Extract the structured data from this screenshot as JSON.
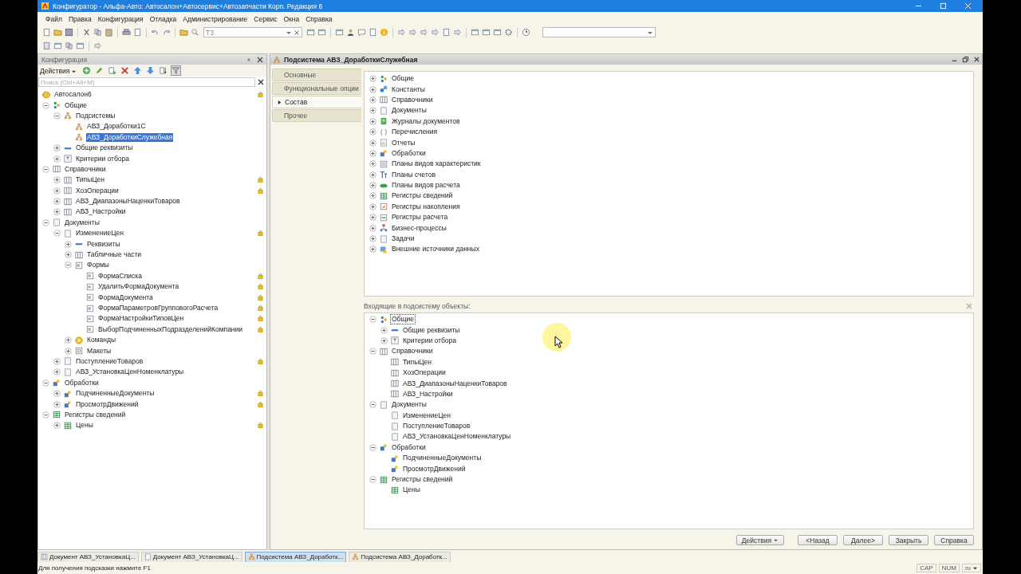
{
  "window": {
    "title": "Конфигуратор - Альфа-Авто: Автосалон+Автосервис+Автозапчасти Корп. Редакция 6"
  },
  "menu": [
    "Файл",
    "Правка",
    "Конфигурация",
    "Отладка",
    "Администрирование",
    "Сервис",
    "Окна",
    "Справка"
  ],
  "toolbar": {
    "search_value": "Т3"
  },
  "config_panel": {
    "title": "Конфигурация",
    "actions_label": "Действия",
    "search_placeholder": "Поиск (Ctrl+Alt+M)",
    "tree": [
      {
        "label": "Автосалон6",
        "kind": "root",
        "selected": false,
        "locked": true,
        "children": [
          {
            "label": "Общие",
            "kind": "common",
            "expanded": true,
            "selected": false,
            "locked": false,
            "children": [
              {
                "label": "Подсистемы",
                "kind": "subsystem",
                "expanded": true,
                "selected": false,
                "locked": false,
                "children": [
                  {
                    "label": "АВЗ_Доработки1С",
                    "kind": "subsystem",
                    "selected": false,
                    "locked": false
                  },
                  {
                    "label": "АВЗ_ДоработкиСлужебная",
                    "kind": "subsystem",
                    "selected": true,
                    "locked": false
                  }
                ]
              },
              {
                "label": "Общие реквизиты",
                "kind": "attributes",
                "expanded": false,
                "selected": false,
                "locked": false
              },
              {
                "label": "Критерии отбора",
                "kind": "filter",
                "expanded": false,
                "selected": false,
                "locked": false
              }
            ]
          },
          {
            "label": "Справочники",
            "kind": "catalog",
            "expanded": true,
            "selected": false,
            "locked": false,
            "children": [
              {
                "label": "ТипыЦен",
                "kind": "catalog",
                "expanded": false,
                "selected": false,
                "locked": true
              },
              {
                "label": "ХозОперации",
                "kind": "catalog",
                "expanded": false,
                "selected": false,
                "locked": true
              },
              {
                "label": "АВЗ_ДиапазоныНаценкиТоваров",
                "kind": "catalog",
                "expanded": false,
                "selected": false,
                "locked": false
              },
              {
                "label": "АВЗ_Настройки",
                "kind": "catalog",
                "expanded": false,
                "selected": false,
                "locked": false
              }
            ]
          },
          {
            "label": "Документы",
            "kind": "document",
            "expanded": true,
            "selected": false,
            "locked": false,
            "children": [
              {
                "label": "ИзменениеЦен",
                "kind": "document",
                "expanded": true,
                "selected": false,
                "locked": true,
                "children": [
                  {
                    "label": "Реквизиты",
                    "kind": "attributes",
                    "expanded": false,
                    "selected": false,
                    "locked": false
                  },
                  {
                    "label": "Табличные части",
                    "kind": "tabular",
                    "expanded": false,
                    "selected": false,
                    "locked": false
                  },
                  {
                    "label": "Формы",
                    "kind": "form",
                    "expanded": true,
                    "selected": false,
                    "locked": false,
                    "children": [
                      {
                        "label": "ФормаСписка",
                        "kind": "form",
                        "selected": false,
                        "locked": true
                      },
                      {
                        "label": "УдалитьФормаДокумента",
                        "kind": "form",
                        "selected": false,
                        "locked": true
                      },
                      {
                        "label": "ФормаДокумента",
                        "kind": "form",
                        "selected": false,
                        "locked": true
                      },
                      {
                        "label": "ФормаПараметровГрупповогоРасчета",
                        "kind": "form",
                        "selected": false,
                        "locked": true
                      },
                      {
                        "label": "ФормаНастройкиТиповЦен",
                        "kind": "form",
                        "selected": false,
                        "locked": true
                      },
                      {
                        "label": "ВыборПодчиненныхПодразделенийКомпании",
                        "kind": "form",
                        "selected": false,
                        "locked": true
                      }
                    ]
                  },
                  {
                    "label": "Команды",
                    "kind": "commands",
                    "expanded": false,
                    "selected": false,
                    "locked": false
                  },
                  {
                    "label": "Макеты",
                    "kind": "templates",
                    "expanded": false,
                    "selected": false,
                    "locked": false
                  }
                ]
              },
              {
                "label": "ПоступлениеТоваров",
                "kind": "document",
                "expanded": false,
                "selected": false,
                "locked": true
              },
              {
                "label": "АВЗ_УстановкаЦенНоменклатуры",
                "kind": "document",
                "expanded": false,
                "selected": false,
                "locked": false
              }
            ]
          },
          {
            "label": "Обработки",
            "kind": "dataprocessor",
            "expanded": true,
            "selected": false,
            "locked": false,
            "children": [
              {
                "label": "ПодчиненныеДокументы",
                "kind": "dataprocessor",
                "expanded": false,
                "selected": false,
                "locked": true
              },
              {
                "label": "ПросмотрДвижений",
                "kind": "dataprocessor",
                "expanded": false,
                "selected": false,
                "locked": true
              }
            ]
          },
          {
            "label": "Регистры сведений",
            "kind": "inforeg",
            "expanded": true,
            "selected": false,
            "locked": false,
            "children": [
              {
                "label": "Цены",
                "kind": "inforeg",
                "expanded": false,
                "selected": false,
                "locked": true
              }
            ]
          }
        ]
      }
    ]
  },
  "subsystem_window": {
    "title": "Подсистема АВЗ_ДоработкиСлужебная",
    "tabs": [
      {
        "label": "Основные",
        "selected": false
      },
      {
        "label": "Функциональные опции",
        "selected": false
      },
      {
        "label": "Состав",
        "selected": true
      },
      {
        "label": "Прочее",
        "selected": false
      }
    ],
    "object_types": [
      {
        "label": "Общие",
        "kind": "common",
        "expanded": false,
        "selected": false
      },
      {
        "label": "Константы",
        "kind": "constants",
        "expanded": false,
        "selected": false
      },
      {
        "label": "Справочники",
        "kind": "catalog",
        "expanded": false,
        "selected": false
      },
      {
        "label": "Документы",
        "kind": "document",
        "expanded": false,
        "selected": false
      },
      {
        "label": "Журналы документов",
        "kind": "journal",
        "expanded": false,
        "selected": false
      },
      {
        "label": "Перечисления",
        "kind": "enum",
        "expanded": false,
        "selected": false
      },
      {
        "label": "Отчеты",
        "kind": "report",
        "expanded": false,
        "selected": false
      },
      {
        "label": "Обработки",
        "kind": "dataprocessor",
        "expanded": false,
        "selected": false
      },
      {
        "label": "Планы видов характеристик",
        "kind": "chartchar",
        "expanded": false,
        "selected": false
      },
      {
        "label": "Планы счетов",
        "kind": "accounts",
        "expanded": false,
        "selected": false
      },
      {
        "label": "Планы видов расчета",
        "kind": "calc",
        "expanded": false,
        "selected": false
      },
      {
        "label": "Регистры сведений",
        "kind": "inforeg",
        "expanded": false,
        "selected": false
      },
      {
        "label": "Регистры накопления",
        "kind": "accumreg",
        "expanded": false,
        "selected": false
      },
      {
        "label": "Регистры расчета",
        "kind": "calcreg",
        "expanded": false,
        "selected": false
      },
      {
        "label": "Бизнес-процессы",
        "kind": "bp",
        "expanded": false,
        "selected": false
      },
      {
        "label": "Задачи",
        "kind": "task",
        "expanded": false,
        "selected": false
      },
      {
        "label": "Внешние источники данных",
        "kind": "external",
        "expanded": false,
        "selected": false
      }
    ],
    "included_label": "Входящие в подсистему объекты:",
    "included_tree": [
      {
        "label": "Общие",
        "kind": "common",
        "expanded": true,
        "selected": true,
        "children": [
          {
            "label": "Общие реквизиты",
            "kind": "attributes",
            "expanded": false,
            "selected": false
          },
          {
            "label": "Критерии отбора",
            "kind": "filter",
            "expanded": false,
            "selected": false
          }
        ]
      },
      {
        "label": "Справочники",
        "kind": "catalog",
        "expanded": true,
        "selected": false,
        "children": [
          {
            "label": "ТипыЦен",
            "kind": "catalog",
            "selected": false
          },
          {
            "label": "ХозОперации",
            "kind": "catalog",
            "selected": false
          },
          {
            "label": "АВЗ_ДиапазоныНаценкиТоваров",
            "kind": "catalog",
            "selected": false
          },
          {
            "label": "АВЗ_Настройки",
            "kind": "catalog",
            "selected": false
          }
        ]
      },
      {
        "label": "Документы",
        "kind": "document",
        "expanded": true,
        "selected": false,
        "children": [
          {
            "label": "ИзменениеЦен",
            "kind": "document",
            "selected": false
          },
          {
            "label": "ПоступлениеТоваров",
            "kind": "document",
            "selected": false
          },
          {
            "label": "АВЗ_УстановкаЦенНоменклатуры",
            "kind": "document",
            "selected": false
          }
        ]
      },
      {
        "label": "Обработки",
        "kind": "dataprocessor",
        "expanded": true,
        "selected": false,
        "children": [
          {
            "label": "ПодчиненныеДокументы",
            "kind": "dataprocessor",
            "selected": false
          },
          {
            "label": "ПросмотрДвижений",
            "kind": "dataprocessor",
            "selected": false
          }
        ]
      },
      {
        "label": "Регистры сведений",
        "kind": "inforeg",
        "expanded": true,
        "selected": false,
        "children": [
          {
            "label": "Цены",
            "kind": "inforeg",
            "selected": false
          }
        ]
      }
    ],
    "buttons": [
      {
        "label": "Действия",
        "kind": "dropdown"
      },
      {
        "label": "<Назад",
        "kind": "plain"
      },
      {
        "label": "Далее>",
        "kind": "plain"
      },
      {
        "label": "Закрыть",
        "kind": "plain"
      },
      {
        "label": "Справка",
        "kind": "plain"
      }
    ]
  },
  "taskbar": [
    {
      "label": "Документ АВЗ_УстановкаЦ...",
      "kind": "document",
      "selected": false
    },
    {
      "label": "Документ АВЗ_УстановкаЦ...",
      "kind": "form",
      "selected": false
    },
    {
      "label": "Подсистема АВЗ_Доработк...",
      "kind": "subsystem",
      "selected": true
    },
    {
      "label": "Подсистема АВЗ_Доработк...",
      "kind": "subsystem",
      "selected": false
    }
  ],
  "status_bar": {
    "hint": "Для получения подсказки нажмите F1",
    "indicators": [
      "CAP",
      "NUM"
    ],
    "language": "ru"
  }
}
